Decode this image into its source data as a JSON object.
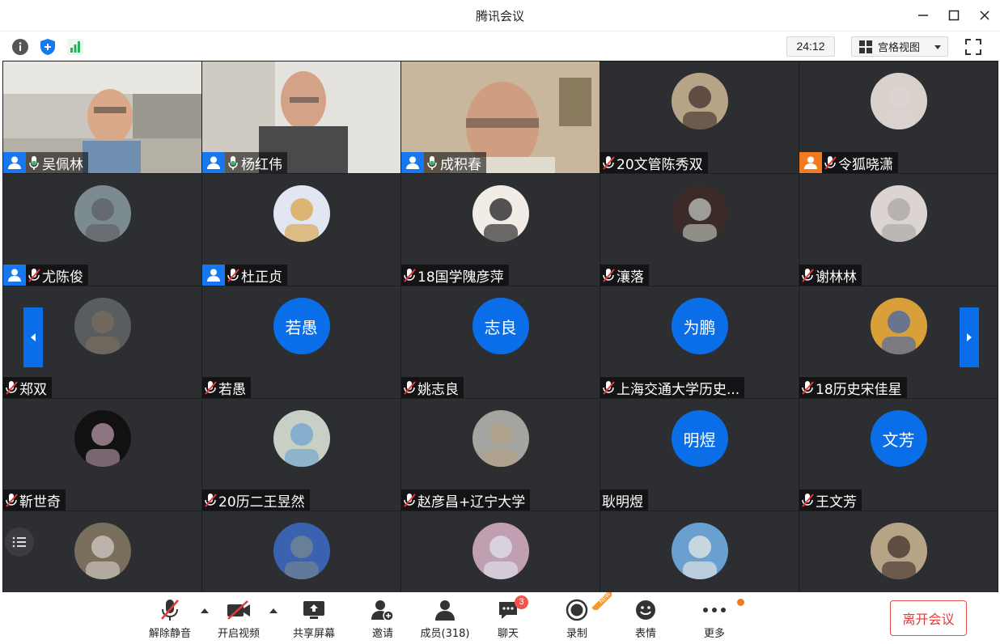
{
  "window": {
    "title": "腾讯会议"
  },
  "toolbar": {
    "timer": "24:12",
    "view_label": "宫格视图"
  },
  "tiles": [
    {
      "name": "吴佩林",
      "host": true,
      "mic": "on"
    },
    {
      "name": "杨红伟",
      "host": true,
      "mic": "on"
    },
    {
      "name": "成积春",
      "host": true,
      "mic": "on"
    },
    {
      "name": "20文管陈秀双",
      "host": false,
      "mic": "off"
    },
    {
      "name": "令狐晓潇",
      "host": true,
      "host_color": "orange",
      "mic": "off"
    },
    {
      "name": "尤陈俊",
      "host": true,
      "mic": "off"
    },
    {
      "name": "杜正贞",
      "host": true,
      "mic": "off"
    },
    {
      "name": "18国学隗彦萍",
      "host": false,
      "mic": "off"
    },
    {
      "name": "瀼落",
      "host": false,
      "mic": "off"
    },
    {
      "name": "谢林林",
      "host": false,
      "mic": "off"
    },
    {
      "name": "郑双",
      "host": false,
      "mic": "off"
    },
    {
      "name": "若愚",
      "host": false,
      "mic": "off",
      "avatar_text": "若愚"
    },
    {
      "name": "姚志良",
      "host": false,
      "mic": "off",
      "avatar_text": "志良"
    },
    {
      "name": "上海交通大学历史...",
      "host": false,
      "mic": "off",
      "avatar_text": "为鹏"
    },
    {
      "name": "18历史宋佳星",
      "host": false,
      "mic": "off"
    },
    {
      "name": "靳世奇",
      "host": false,
      "mic": "off"
    },
    {
      "name": "20历二王昱然",
      "host": false,
      "mic": "off"
    },
    {
      "name": "赵彦昌+辽宁大学",
      "host": false,
      "mic": "off"
    },
    {
      "name": "耿明煜",
      "host": false,
      "mic": "none",
      "avatar_text": "明煜"
    },
    {
      "name": "王文芳",
      "host": false,
      "mic": "off",
      "avatar_text": "文芳"
    },
    {
      "name": "",
      "host": false,
      "mic": "none"
    },
    {
      "name": "",
      "host": false,
      "mic": "none"
    },
    {
      "name": "",
      "host": false,
      "mic": "none"
    },
    {
      "name": "",
      "host": false,
      "mic": "none"
    },
    {
      "name": "",
      "host": false,
      "mic": "none"
    }
  ],
  "bottom": {
    "unmute": "解除静音",
    "video": "开启视频",
    "share": "共享屏幕",
    "invite": "邀请",
    "members": "成员(318)",
    "chat": "聊天",
    "chat_badge": "3",
    "record": "录制",
    "record_badge": "NEW",
    "emoji": "表情",
    "more": "更多",
    "leave": "离开会议"
  },
  "colors": {
    "accent": "#0a6ee8",
    "leave": "#e33a3a",
    "active_speaker": "#23c25a"
  }
}
